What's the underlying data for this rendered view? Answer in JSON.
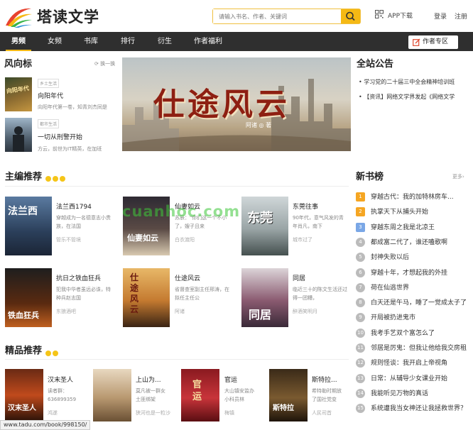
{
  "header": {
    "logo_text": "塔读文学",
    "search_placeholder": "请输入书名、作者、关键词",
    "app_download": "APP下载",
    "login": "登录",
    "register": "注册"
  },
  "nav": {
    "items": [
      "男频",
      "女频",
      "书库",
      "排行",
      "衍生",
      "作者福利"
    ],
    "author_zone": "作者专区"
  },
  "trending": {
    "title": "风向标",
    "refresh": "换一换",
    "books": [
      {
        "tag": "乡土生活",
        "title": "向阳年代",
        "desc": "向阳年代第一卷，知青刘杰同是",
        "cover_text": "向阳年代"
      },
      {
        "tag": "都市生活",
        "title": "一切从刑警开始",
        "desc": "方云，前世为IT精英，在加班",
        "cover_text": ""
      }
    ]
  },
  "banner": {
    "title": "仕途风云",
    "author_line": "阿诸 ◎ 著"
  },
  "notice": {
    "title": "全站公告",
    "items": [
      "学习党的二十届三中全会精神培训班",
      "【资讯】网络文学界发起《网络文学"
    ]
  },
  "editor_picks": {
    "title": "主编推荐",
    "books": [
      {
        "title": "法兰西1794",
        "desc": "穿越成为一名德意志小贵族，在法国",
        "author": "管乐不管境",
        "cover_text": "法兰西"
      },
      {
        "title": "仙妻如云",
        "desc": "苏辰：\"你们这一个不小了，嫂子且来",
        "author": "白衣渡阳",
        "cover_text": "仙妻如云"
      },
      {
        "title": "东莞往事",
        "desc": "90年代，意气风发的青年肖凡，南下",
        "author": "城市过了",
        "cover_text": "东莞"
      },
      {
        "title": "抗日之铁血狂兵",
        "desc": "犯我中华者虽远必诛，特种兵赵志国",
        "author": "东狼酒吧",
        "cover_text": "铁血狂兵"
      },
      {
        "title": "仕途风云",
        "desc": "省督查室副主任邢涛，在拟任主任公",
        "author": "阿诸",
        "cover_text": "仕途风云"
      },
      {
        "title": "同居",
        "desc": "临近三十的陈文生活还过得一团糟，",
        "author": "醉酒笑明月",
        "cover_text": "同居"
      }
    ]
  },
  "watermark": "cuanhoc.com",
  "new_books": {
    "title": "新书榜",
    "more": "更多",
    "items": [
      "穿越古代：我的加特林房车...",
      "执掌天下从捕头开始",
      "穿越东周之我是北凉王",
      "都成富二代了，谁还嗑歌啊",
      "封神失败以后",
      "穿越十年，才想起我的外挂",
      "荷在仙逃世界",
      "白天还是午马，睡了一觉成太子了",
      "开局被扔进鬼市",
      "我考手艺双个富怎么了",
      "邻居是厉鬼：但我让他给我交房租",
      "规则怪谈：我开启上帝视角",
      "日常：从辅导少女课业开始",
      "我能听见万物的真话",
      "系统遭我当女神还让我拯救世界？"
    ],
    "colors": [
      "#f5a623",
      "#f5a623",
      "#7aa7e6",
      "#bbbbbb"
    ]
  },
  "quality_picks": {
    "title": "精品推荐",
    "books": [
      {
        "title": "汉末圣人",
        "desc": "读者群：636899359",
        "author": "鸿遂",
        "cover_text": "汉末圣人"
      },
      {
        "title": "上山为...",
        "desc": "莫凡被一群女土匪绑架",
        "author": "狭河也是一粒沙",
        "cover_text": ""
      },
      {
        "title": "官运",
        "desc": "大山镇安监办小科员林",
        "author": "梅镇",
        "cover_text": "官运"
      },
      {
        "title": "斯特拉...",
        "desc": "希特勒时期放了国社党变",
        "author": "人民司首",
        "cover_text": "斯特拉"
      }
    ]
  },
  "status_url": "www.tadu.com/book/998150/"
}
